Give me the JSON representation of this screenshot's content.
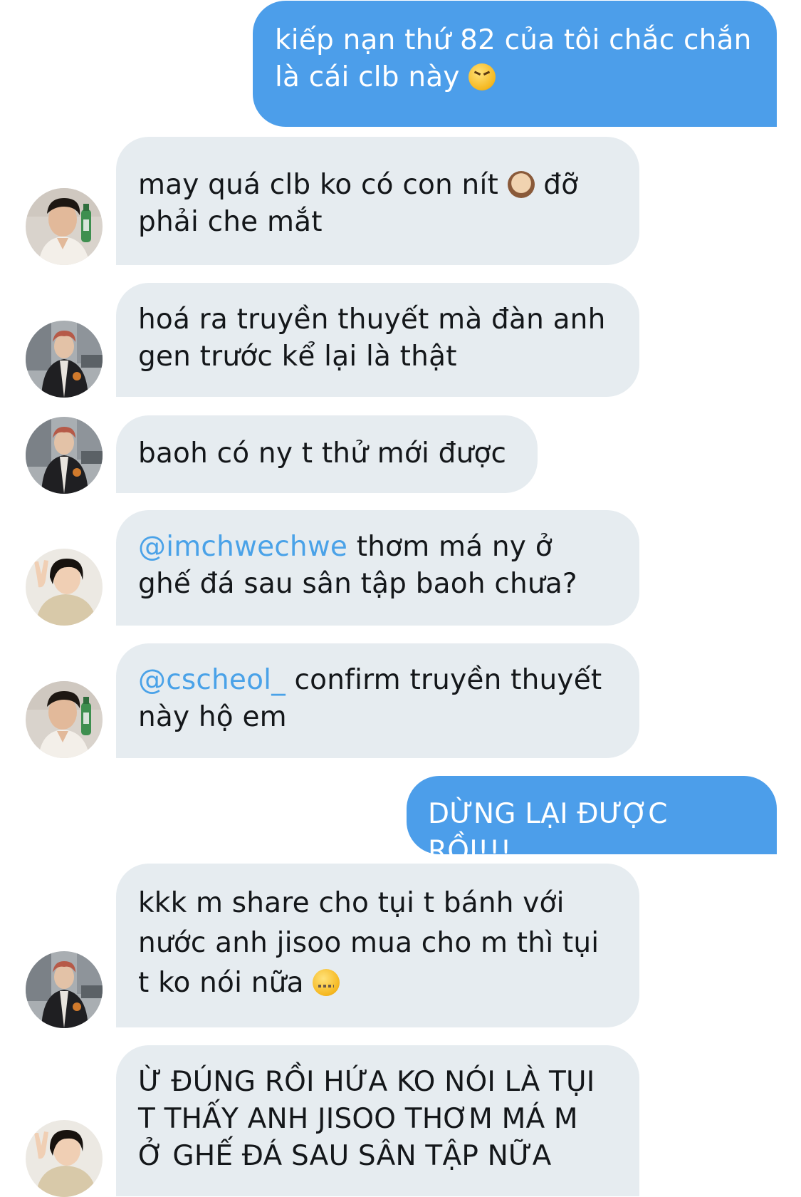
{
  "messages": [
    {
      "direction": "sent",
      "text": "kiếp nạn thứ 82 của tôi chắc chắn là cái clb này",
      "emoji": "tired-face-emoji"
    },
    {
      "direction": "received",
      "avatar": "avatar-bottle",
      "text_before": "may quá clb ko có con nít",
      "emoji": "see-no-evil-monkey-emoji",
      "text_after": "đỡ phải che mắt"
    },
    {
      "direction": "received",
      "avatar": "avatar-jacket",
      "text": "hoá ra truyền thuyết mà đàn anh gen trước kể lại là thật"
    },
    {
      "direction": "received",
      "avatar": "avatar-jacket",
      "text": "baoh có ny t thử mới được"
    },
    {
      "direction": "received",
      "avatar": "avatar-peace",
      "mention": "@imchwechwe",
      "text": "thơm má ny ở ghế đá sau sân tập baoh chưa?"
    },
    {
      "direction": "received",
      "avatar": "avatar-bottle",
      "mention": "@cscheol_",
      "text": "confirm truyền thuyết này hộ em"
    },
    {
      "direction": "sent",
      "text": "DỪNG LẠI ĐƯỢC RỒI!!!"
    },
    {
      "direction": "received",
      "avatar": "avatar-jacket",
      "text": "kkk m share cho tụi t bánh với nước anh jisoo mua cho m thì tụi t ko nói nữa",
      "emoji": "zipper-mouth-face-emoji"
    },
    {
      "direction": "received",
      "avatar": "avatar-peace",
      "text": "Ừ ĐÚNG RỒI HỨA KO NÓI LÀ TỤI T THẤY ANH JISOO THƠM MÁ M Ở GHẾ ĐÁ SAU SÂN TẬP NỮA"
    }
  ],
  "colors": {
    "sent_bubble": "#4c9eea",
    "received_bubble": "#e6ecf0",
    "mention": "#4aa2e8",
    "text": "#14171a"
  }
}
